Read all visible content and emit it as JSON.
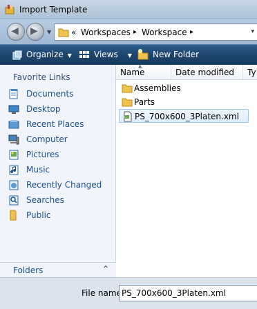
{
  "window": {
    "title": "Import Template"
  },
  "address": {
    "overflow": "«",
    "crumbs": [
      "Workspaces",
      "Workspace"
    ],
    "sep": "▸",
    "dropdown": "▾"
  },
  "nav": {
    "back": "◀",
    "forward": "▶",
    "dropdown": "▼"
  },
  "toolbar": {
    "organize": "Organize",
    "views": "Views",
    "new_folder": "New Folder",
    "arrow": "▼"
  },
  "sidebar": {
    "heading": "Favorite Links",
    "items": [
      "Documents",
      "Desktop",
      "Recent Places",
      "Computer",
      "Pictures",
      "Music",
      "Recently Changed",
      "Searches",
      "Public"
    ],
    "folders_label": "Folders",
    "folders_chevron": "⌃"
  },
  "columns": {
    "name": "Name",
    "date": "Date modified",
    "type": "Ty",
    "sort": "▲"
  },
  "files": [
    {
      "name": "Assemblies",
      "kind": "folder"
    },
    {
      "name": "Parts",
      "kind": "folder"
    },
    {
      "name": "PS_700x600_3Platen.xml",
      "kind": "xml",
      "selected": true
    }
  ],
  "filename": {
    "label": "File name:",
    "value": "PS_700x600_3Platen.xml"
  },
  "colors": {
    "link": "#1a4f8a",
    "toolbar": "#1d466f",
    "selection": "#dcedfc"
  }
}
